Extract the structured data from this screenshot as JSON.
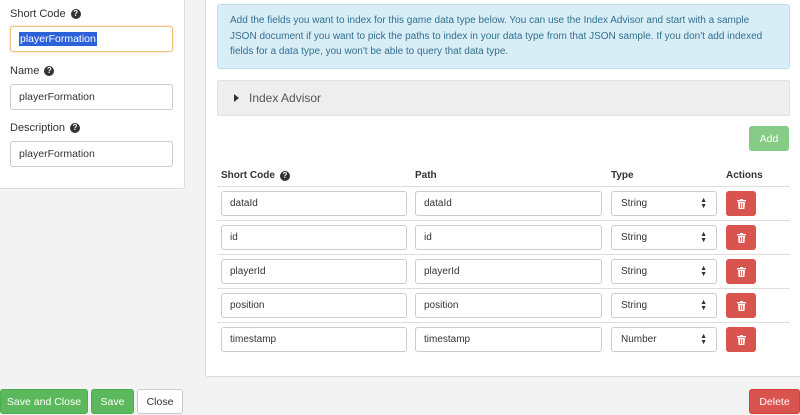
{
  "left": {
    "short_code_label": "Short Code",
    "short_code_value": "playerFormation",
    "name_label": "Name",
    "name_value": "playerFormation",
    "description_label": "Description",
    "description_value": "playerFormation"
  },
  "main": {
    "info_text": "Add the fields you want to index for this game data type below. You can use the Index Advisor and start with a sample JSON document if you want to pick the paths to index in your data type from that JSON sample. If you don't add indexed fields for a data type, you won't be able to query that data type.",
    "advisor_label": "Index Advisor",
    "add_label": "Add",
    "headers": {
      "short_code": "Short Code",
      "path": "Path",
      "type": "Type",
      "actions": "Actions"
    },
    "rows": [
      {
        "short_code": "dataId",
        "path": "dataId",
        "type": "String"
      },
      {
        "short_code": "id",
        "path": "id",
        "type": "String"
      },
      {
        "short_code": "playerId",
        "path": "playerId",
        "type": "String"
      },
      {
        "short_code": "position",
        "path": "position",
        "type": "String"
      },
      {
        "short_code": "timestamp",
        "path": "timestamp",
        "type": "Number"
      }
    ]
  },
  "footer": {
    "save_close": "Save and Close",
    "save": "Save",
    "close": "Close",
    "delete": "Delete"
  },
  "colors": {
    "green": "#5cb85c",
    "red": "#d9534f",
    "info_bg": "#d9edf7",
    "selection": "#2b62d9"
  }
}
